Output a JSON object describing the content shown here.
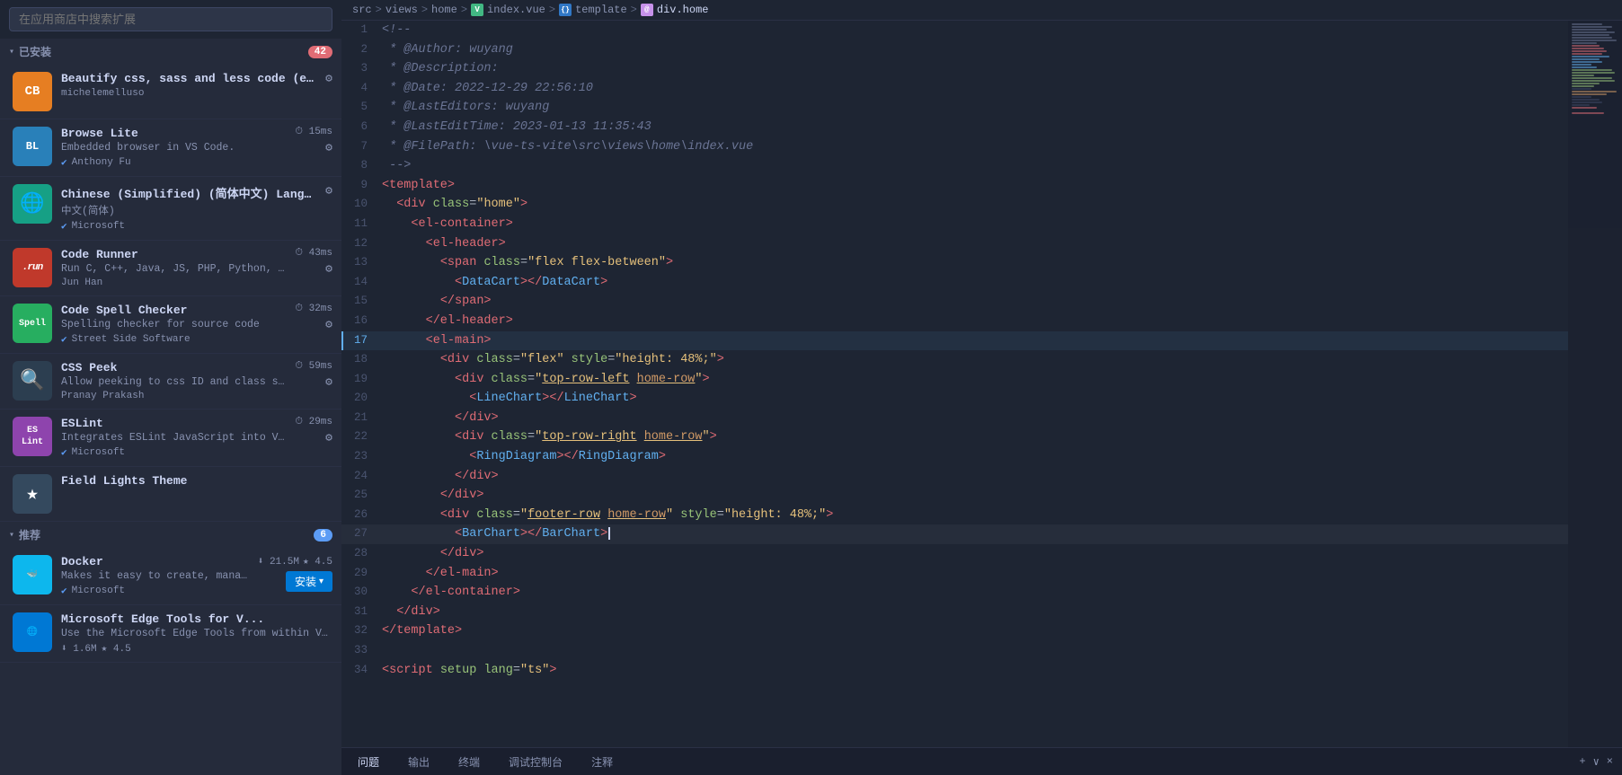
{
  "sidebar": {
    "search_placeholder": "在应用商店中搜索扩展",
    "installed_label": "已安装",
    "installed_badge": "42",
    "recommended_label": "推荐",
    "recommended_badge": "6",
    "installed_extensions": [
      {
        "id": "beautify-css",
        "icon_text": "cb",
        "icon_bg": "#e67e22",
        "name": "Beautify css, sass and less code (extension t...",
        "desc": "",
        "author": "michelemelluso",
        "verified": false,
        "time": "",
        "show_gear": true
      },
      {
        "id": "browse-lite",
        "icon_text": "BL",
        "icon_bg": "#2980b9",
        "name": "Browse Lite",
        "desc": "Embedded browser in VS Code.",
        "author": "Anthony Fu",
        "verified": true,
        "time": "15ms",
        "show_gear": true
      },
      {
        "id": "chinese-lang",
        "icon_text": "🌐",
        "icon_bg": "#16a085",
        "name": "Chinese (Simplified) (简体中文) Languag...",
        "desc": "中文(简体)",
        "author": "Microsoft",
        "verified": true,
        "time": "",
        "show_gear": true
      },
      {
        "id": "code-runner",
        "icon_text": ".run",
        "icon_bg": "#c0392b",
        "name": "Code Runner",
        "desc": "Run C, C++, Java, JS, PHP, Python, Perl, Rub...",
        "author": "Jun Han",
        "verified": false,
        "time": "43ms",
        "show_gear": true
      },
      {
        "id": "code-spell-checker",
        "icon_text": "Spell",
        "icon_bg": "#27ae60",
        "name": "Code Spell Checker",
        "desc": "Spelling checker for source code",
        "author": "Street Side Software",
        "verified": true,
        "time": "32ms",
        "show_gear": true
      },
      {
        "id": "css-peek",
        "icon_text": "🔍",
        "icon_bg": "#2c3e50",
        "name": "CSS Peek",
        "desc": "Allow peeking to css ID and class strings as ...",
        "author": "Pranay Prakash",
        "verified": false,
        "time": "59ms",
        "show_gear": true
      },
      {
        "id": "eslint",
        "icon_text": "ES Lint",
        "icon_bg": "#8e44ad",
        "name": "ESLint",
        "desc": "Integrates ESLint JavaScript into VS Code.",
        "author": "Microsoft",
        "verified": true,
        "time": "29ms",
        "show_gear": true
      },
      {
        "id": "field-lights-theme",
        "icon_text": "★",
        "icon_bg": "#34495e",
        "name": "Field Lights Theme",
        "desc": "",
        "author": "",
        "verified": false,
        "time": "",
        "show_gear": false
      }
    ],
    "recommended_extensions": [
      {
        "id": "docker",
        "icon_text": "docker",
        "icon_bg": "#0db7ed",
        "name": "Docker",
        "desc": "Makes it easy to create, manage, and debu...",
        "author": "Microsoft",
        "verified": true,
        "time": "21.5M",
        "rating": "4.5",
        "show_install": true
      },
      {
        "id": "ms-edge-tools",
        "icon_text": "edge",
        "icon_bg": "#0078d4",
        "name": "Microsoft Edge Tools for V...",
        "desc": "Use the Microsoft Edge Tools from within V...",
        "author": "",
        "verified": false,
        "time": "1.6M",
        "rating": "4.5",
        "show_install": false
      }
    ],
    "bottom_tabs": [
      "问题",
      "输出",
      "终端",
      "调试控制台",
      "注释"
    ]
  },
  "breadcrumb": {
    "parts": [
      "src",
      "views",
      "home",
      "index.vue",
      "{} template",
      "div.home"
    ],
    "separator": ">"
  },
  "editor": {
    "lines": [
      {
        "num": 1,
        "content": "<!--",
        "type": "comment"
      },
      {
        "num": 2,
        "content": " * @Author: wuyang",
        "type": "comment"
      },
      {
        "num": 3,
        "content": " * @Description:",
        "type": "comment"
      },
      {
        "num": 4,
        "content": " * @Date: 2022-12-29 22:56:10",
        "type": "comment"
      },
      {
        "num": 5,
        "content": " * @LastEditors: wuyang",
        "type": "comment"
      },
      {
        "num": 6,
        "content": " * @LastEditTime: 2023-01-13 11:35:43",
        "type": "comment"
      },
      {
        "num": 7,
        "content": " * @FilePath: \\vue-ts-vite\\src\\views\\home\\index.vue",
        "type": "comment"
      },
      {
        "num": 8,
        "content": " -->",
        "type": "comment"
      },
      {
        "num": 9,
        "content": "<template>",
        "type": "tag"
      },
      {
        "num": 10,
        "content": "  <div class=\"home\">",
        "type": "tag"
      },
      {
        "num": 11,
        "content": "    <el-container>",
        "type": "tag"
      },
      {
        "num": 12,
        "content": "      <el-header>",
        "type": "tag"
      },
      {
        "num": 13,
        "content": "        <span class=\"flex flex-between\">",
        "type": "tag"
      },
      {
        "num": 14,
        "content": "          <DataCart></DataCart>",
        "type": "component"
      },
      {
        "num": 15,
        "content": "        </span>",
        "type": "tag"
      },
      {
        "num": 16,
        "content": "      </el-header>",
        "type": "tag"
      },
      {
        "num": 17,
        "content": "      <el-main>",
        "type": "tag",
        "highlight": true
      },
      {
        "num": 18,
        "content": "        <div class=\"flex\" style=\"height: 48%;\">",
        "type": "mixed"
      },
      {
        "num": 19,
        "content": "          <div class=\"top-row-left home-row\">",
        "type": "mixed"
      },
      {
        "num": 20,
        "content": "            <LineChart></LineChart>",
        "type": "component"
      },
      {
        "num": 21,
        "content": "          </div>",
        "type": "tag"
      },
      {
        "num": 22,
        "content": "          <div class=\"top-row-right home-row\">",
        "type": "mixed"
      },
      {
        "num": 23,
        "content": "            <RingDiagram></RingDiagram>",
        "type": "component"
      },
      {
        "num": 24,
        "content": "          </div>",
        "type": "tag"
      },
      {
        "num": 25,
        "content": "        </div>",
        "type": "tag"
      },
      {
        "num": 26,
        "content": "        <div class=\"footer-row home-row\" style=\"height: 48%;\">",
        "type": "mixed"
      },
      {
        "num": 27,
        "content": "          <BarChart></BarChart>",
        "type": "component"
      },
      {
        "num": 28,
        "content": "        </div>",
        "type": "tag"
      },
      {
        "num": 29,
        "content": "      </el-main>",
        "type": "tag"
      },
      {
        "num": 30,
        "content": "    </el-container>",
        "type": "tag"
      },
      {
        "num": 31,
        "content": "  </div>",
        "type": "tag"
      },
      {
        "num": 32,
        "content": "</template>",
        "type": "tag"
      },
      {
        "num": 33,
        "content": "",
        "type": "empty"
      },
      {
        "num": 34,
        "content": "<script setup lang=\"ts\">",
        "type": "tag"
      }
    ]
  },
  "status_bar": {
    "tabs": [
      "问题",
      "输出",
      "终端",
      "调试控制台",
      "注释"
    ],
    "right_actions": [
      "+",
      "∨",
      "×"
    ]
  }
}
